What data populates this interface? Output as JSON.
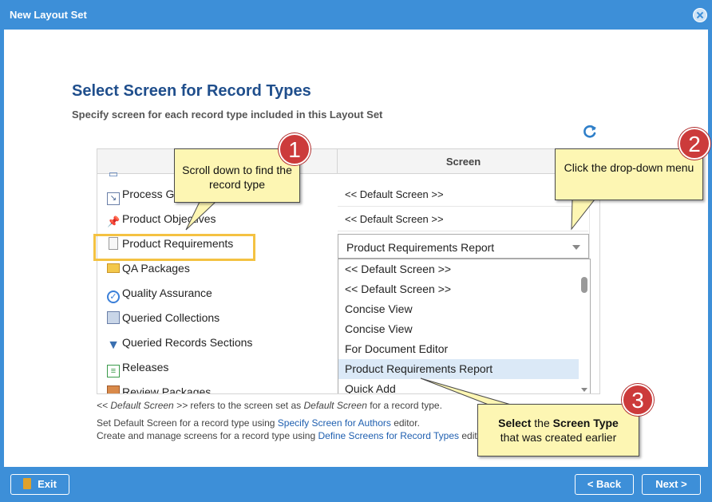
{
  "window": {
    "title": "New Layout Set"
  },
  "page": {
    "heading": "Select Screen for Record Types",
    "subheading": "Specify screen for each record type included in this Layout Set"
  },
  "grid": {
    "header_screen": "Screen",
    "rows": [
      {
        "name": "Process Gu",
        "icon": "process-guide-icon",
        "screen": "<< Default Screen >>"
      },
      {
        "name": "Product Objectives",
        "icon": "pushpin-icon",
        "screen": "<< Default Screen >>"
      },
      {
        "name": "Product Requirements",
        "icon": "document-icon",
        "screen": "Product Requirements Report"
      },
      {
        "name": "QA Packages",
        "icon": "folder-icon",
        "screen": ""
      },
      {
        "name": "Quality Assurance",
        "icon": "check-circle-icon",
        "screen": ""
      },
      {
        "name": "Queried Collections",
        "icon": "collections-icon",
        "screen": ""
      },
      {
        "name": "Queried Records Sections",
        "icon": "filter-icon",
        "screen": ""
      },
      {
        "name": "Releases",
        "icon": "list-icon",
        "screen": ""
      },
      {
        "name": "Review Packages",
        "icon": "package-icon",
        "screen": ""
      }
    ],
    "dropdown_options": [
      "<< Default Screen >>",
      "<< Default Screen >>",
      "Concise View",
      "Concise View",
      "For Document Editor",
      "Product Requirements Report",
      "Quick Add"
    ],
    "dropdown_selected": "Product Requirements Report"
  },
  "notes": {
    "line1_a": "<< Default Screen >>",
    "line1_b": " refers to the screen set as ",
    "line1_c": "Default Screen",
    "line1_d": " for a record type.",
    "line2_a": "Set Default Screen for a record type using ",
    "line2_link": "Specify Screen for Authors",
    "line2_b": " editor.",
    "line3_a": "Create and manage screens for a record type using ",
    "line3_link": "Define Screens for Record Types",
    "line3_b": " edit"
  },
  "callouts": {
    "c1_text": "Scroll down to find the record type",
    "c1_num": "1",
    "c2_text": "Click the drop-down menu",
    "c2_num": "2",
    "c3_bold1": "Select",
    "c3_mid": " the ",
    "c3_bold2": "Screen Type",
    "c3_rest": "that was created earlier",
    "c3_num": "3"
  },
  "footer": {
    "exit_label": "Exit",
    "back_label": "< Back",
    "next_label": "Next >"
  },
  "colors": {
    "accent": "#3d8fd8",
    "heading": "#1f4e8c",
    "highlight": "#f4c242",
    "callout_fill": "#fdf6b3",
    "badge": "#cc3b3b",
    "selected_option": "#dbe9f7"
  }
}
